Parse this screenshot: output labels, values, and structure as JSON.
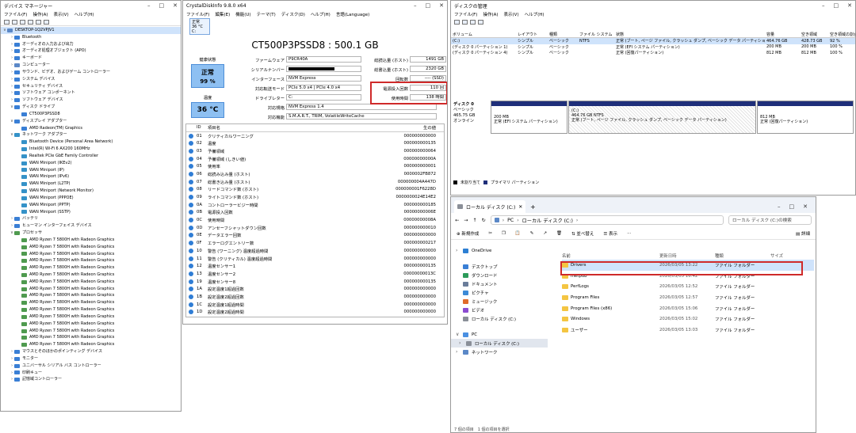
{
  "device_manager": {
    "title": "デバイス マネージャー",
    "menu": [
      "ファイル(F)",
      "操作(A)",
      "表示(V)",
      "ヘルプ(H)"
    ],
    "tree": [
      {
        "label": "DESKTOP-1Q2VPJV1",
        "exp": "∨",
        "indent": 0,
        "icon": "pc",
        "selected": true
      },
      {
        "label": "Bluetooth",
        "exp": "›",
        "indent": 1,
        "icon": "dev"
      },
      {
        "label": "オーディオの入力および出力",
        "exp": "›",
        "indent": 1,
        "icon": "dev"
      },
      {
        "label": "オーディオ処理オブジェクト (APO)",
        "exp": "›",
        "indent": 1,
        "icon": "dev"
      },
      {
        "label": "キーボード",
        "exp": "›",
        "indent": 1,
        "icon": "dev"
      },
      {
        "label": "コンピューター",
        "exp": "›",
        "indent": 1,
        "icon": "pc"
      },
      {
        "label": "サウンド、ビデオ、およびゲーム コントローラー",
        "exp": "›",
        "indent": 1,
        "icon": "dev"
      },
      {
        "label": "システム デバイス",
        "exp": "›",
        "indent": 1,
        "icon": "dev"
      },
      {
        "label": "セキュリティ デバイス",
        "exp": "›",
        "indent": 1,
        "icon": "dev"
      },
      {
        "label": "ソフトウェア コンポーネント",
        "exp": "›",
        "indent": 1,
        "icon": "dev"
      },
      {
        "label": "ソフトウェア デバイス",
        "exp": "›",
        "indent": 1,
        "icon": "dev"
      },
      {
        "label": "ディスク ドライブ",
        "exp": "∨",
        "indent": 1,
        "icon": "dev"
      },
      {
        "label": "CT500P3PSSD8",
        "exp": "",
        "indent": 2,
        "icon": "dev"
      },
      {
        "label": "ディスプレイ アダプター",
        "exp": "∨",
        "indent": 1,
        "icon": "dev"
      },
      {
        "label": "AMD Radeon(TM) Graphics",
        "exp": "",
        "indent": 2,
        "icon": "dev"
      },
      {
        "label": "ネットワーク アダプター",
        "exp": "∨",
        "indent": 1,
        "icon": "net"
      },
      {
        "label": "Bluetooth Device (Personal Area Network)",
        "exp": "",
        "indent": 2,
        "icon": "net"
      },
      {
        "label": "Intel(R) Wi-Fi 6 AX200 160MHz",
        "exp": "",
        "indent": 2,
        "icon": "net"
      },
      {
        "label": "Realtek PCIe GbE Family Controller",
        "exp": "",
        "indent": 2,
        "icon": "net"
      },
      {
        "label": "WAN Miniport (IKEv2)",
        "exp": "",
        "indent": 2,
        "icon": "net"
      },
      {
        "label": "WAN Miniport (IP)",
        "exp": "",
        "indent": 2,
        "icon": "net"
      },
      {
        "label": "WAN Miniport (IPv6)",
        "exp": "",
        "indent": 2,
        "icon": "net"
      },
      {
        "label": "WAN Miniport (L2TP)",
        "exp": "",
        "indent": 2,
        "icon": "net"
      },
      {
        "label": "WAN Miniport (Network Monitor)",
        "exp": "",
        "indent": 2,
        "icon": "net"
      },
      {
        "label": "WAN Miniport (PPPOE)",
        "exp": "",
        "indent": 2,
        "icon": "net"
      },
      {
        "label": "WAN Miniport (PPTP)",
        "exp": "",
        "indent": 2,
        "icon": "net"
      },
      {
        "label": "WAN Miniport (SSTP)",
        "exp": "",
        "indent": 2,
        "icon": "net"
      },
      {
        "label": "バッテリ",
        "exp": "›",
        "indent": 1,
        "icon": "dev"
      },
      {
        "label": "ヒューマン インターフェイス デバイス",
        "exp": "›",
        "indent": 1,
        "icon": "dev"
      },
      {
        "label": "プロセッサ",
        "exp": "∨",
        "indent": 1,
        "icon": "cpu"
      },
      {
        "label": "AMD Ryzen 7 5800H with Radeon Graphics",
        "exp": "",
        "indent": 2,
        "icon": "cpu"
      },
      {
        "label": "AMD Ryzen 7 5800H with Radeon Graphics",
        "exp": "",
        "indent": 2,
        "icon": "cpu"
      },
      {
        "label": "AMD Ryzen 7 5800H with Radeon Graphics",
        "exp": "",
        "indent": 2,
        "icon": "cpu"
      },
      {
        "label": "AMD Ryzen 7 5800H with Radeon Graphics",
        "exp": "",
        "indent": 2,
        "icon": "cpu"
      },
      {
        "label": "AMD Ryzen 7 5800H with Radeon Graphics",
        "exp": "",
        "indent": 2,
        "icon": "cpu"
      },
      {
        "label": "AMD Ryzen 7 5800H with Radeon Graphics",
        "exp": "",
        "indent": 2,
        "icon": "cpu"
      },
      {
        "label": "AMD Ryzen 7 5800H with Radeon Graphics",
        "exp": "",
        "indent": 2,
        "icon": "cpu"
      },
      {
        "label": "AMD Ryzen 7 5800H with Radeon Graphics",
        "exp": "",
        "indent": 2,
        "icon": "cpu"
      },
      {
        "label": "AMD Ryzen 7 5800H with Radeon Graphics",
        "exp": "",
        "indent": 2,
        "icon": "cpu"
      },
      {
        "label": "AMD Ryzen 7 5800H with Radeon Graphics",
        "exp": "",
        "indent": 2,
        "icon": "cpu"
      },
      {
        "label": "AMD Ryzen 7 5800H with Radeon Graphics",
        "exp": "",
        "indent": 2,
        "icon": "cpu"
      },
      {
        "label": "AMD Ryzen 7 5800H with Radeon Graphics",
        "exp": "",
        "indent": 2,
        "icon": "cpu"
      },
      {
        "label": "AMD Ryzen 7 5800H with Radeon Graphics",
        "exp": "",
        "indent": 2,
        "icon": "cpu"
      },
      {
        "label": "AMD Ryzen 7 5800H with Radeon Graphics",
        "exp": "",
        "indent": 2,
        "icon": "cpu"
      },
      {
        "label": "AMD Ryzen 7 5800H with Radeon Graphics",
        "exp": "",
        "indent": 2,
        "icon": "cpu"
      },
      {
        "label": "AMD Ryzen 7 5800H with Radeon Graphics",
        "exp": "",
        "indent": 2,
        "icon": "cpu"
      },
      {
        "label": "マウスとそのほかのポインティング デバイス",
        "exp": "›",
        "indent": 1,
        "icon": "dev"
      },
      {
        "label": "モニター",
        "exp": "›",
        "indent": 1,
        "icon": "dev"
      },
      {
        "label": "ユニバーサル シリアル バス コントローラー",
        "exp": "›",
        "indent": 1,
        "icon": "dev"
      },
      {
        "label": "印刷キュー",
        "exp": "›",
        "indent": 1,
        "icon": "dev"
      },
      {
        "label": "記憶域コントローラー",
        "exp": "›",
        "indent": 1,
        "icon": "dev"
      }
    ]
  },
  "cdi": {
    "title": "CrystalDiskInfo 9.8.0 x64",
    "menu": [
      "ファイル(F)",
      "編集(E)",
      "機能(U)",
      "テーマ(T)",
      "ディスク(D)",
      "ヘルプ(H)",
      "言語(Language)"
    ],
    "mini_status": "正常",
    "mini_temp": "36 °C",
    "mini_drive": "C:",
    "model": "CT500P3PSSD8 : 500.1 GB",
    "health_label": "健康状態",
    "health_status": "正常",
    "health_percent": "99 %",
    "temp_label": "温度",
    "temp_value": "36 °C",
    "firmware_label": "ファームウェア",
    "firmware": "P9CR40A",
    "serial_label": "シリアルナンバー",
    "interface_label": "インターフェース",
    "interface": "NVM Express",
    "transfer_label": "対応転送モード",
    "transfer": "PCIe 5.0 x4 | PCIe 4.0 x4",
    "drive_letter_label": "ドライブレター",
    "drive_letter": "C:",
    "standard_label": "対応規格",
    "standard": "NVM Express 1.4",
    "features_label": "対応機能",
    "features": "S.M.A.R.T., TRIM, VolatileWriteCache",
    "host_reads_label": "総読込量 (ホスト)",
    "host_reads": "1491 GB",
    "host_writes_label": "総書込量 (ホスト)",
    "host_writes": "2320 GB",
    "rotation_label": "回転数",
    "rotation": "---- (SSD)",
    "power_on_count_label": "電源投入回数",
    "power_on_count": "110 回",
    "power_on_hours_label": "使用時間",
    "power_on_hours": "138 時間",
    "smart_headers": {
      "id": "ID",
      "name": "項目名",
      "raw": "生の値"
    },
    "smart": [
      {
        "id": "01",
        "name": "クリティカルワーニング",
        "raw": "000000000000"
      },
      {
        "id": "02",
        "name": "温度",
        "raw": "000000000135"
      },
      {
        "id": "03",
        "name": "予備領域",
        "raw": "000000000064"
      },
      {
        "id": "04",
        "name": "予備領域 (しきい値)",
        "raw": "00000000000A"
      },
      {
        "id": "05",
        "name": "使用率",
        "raw": "000000000001"
      },
      {
        "id": "06",
        "name": "総読み込み量 (ホスト)",
        "raw": "0000002FB872"
      },
      {
        "id": "07",
        "name": "総書き込み量 (ホスト)",
        "raw": "000000004A447D"
      },
      {
        "id": "08",
        "name": "リードコマンド数 (ホスト)",
        "raw": "000000001F6228D"
      },
      {
        "id": "09",
        "name": "ライトコマンド数 (ホスト)",
        "raw": "0000000024E14E2"
      },
      {
        "id": "0A",
        "name": "コントローラービジー時間",
        "raw": "000000000185"
      },
      {
        "id": "0B",
        "name": "電源投入回数",
        "raw": "00000000006E"
      },
      {
        "id": "0C",
        "name": "使用時間",
        "raw": "00000000008A"
      },
      {
        "id": "0D",
        "name": "アンセーフシャットダウン回数",
        "raw": "000000000010"
      },
      {
        "id": "0E",
        "name": "データエラー回数",
        "raw": "000000000000"
      },
      {
        "id": "0F",
        "name": "エラーログエントリー数",
        "raw": "000000000217"
      },
      {
        "id": "10",
        "name": "警告 (ワーニング) 温度超過時間",
        "raw": "000000000000"
      },
      {
        "id": "11",
        "name": "警告 (クリティカル) 温度超過時間",
        "raw": "000000000000"
      },
      {
        "id": "12",
        "name": "温度センサー1",
        "raw": "000000000135"
      },
      {
        "id": "13",
        "name": "温度センサー2",
        "raw": "00000000013C"
      },
      {
        "id": "19",
        "name": "温度センサー8",
        "raw": "000000000135"
      },
      {
        "id": "1A",
        "name": "設定温度1超過回数",
        "raw": "000000000000"
      },
      {
        "id": "1B",
        "name": "設定温度2超過回数",
        "raw": "000000000000"
      },
      {
        "id": "1C",
        "name": "設定温度1超過時間",
        "raw": "000000000000"
      },
      {
        "id": "1D",
        "name": "設定温度2超過時間",
        "raw": "000000000000"
      }
    ]
  },
  "disk_mgmt": {
    "title": "ディスクの管理",
    "menu": [
      "ファイル(F)",
      "操作(A)",
      "表示(V)",
      "ヘルプ(H)"
    ],
    "headers": [
      "ボリューム",
      "レイアウト",
      "種類",
      "ファイル システム",
      "状態",
      "容量",
      "空き領域",
      "空き領域の割合"
    ],
    "volumes": [
      {
        "name": "(C:)",
        "layout": "シンプル",
        "type": "ベーシック",
        "fs": "NTFS",
        "status": "正常 (ブート, ページ ファイル, クラッシュ ダンプ, ベーシック データ パーティション)",
        "size": "464.76 GB",
        "free": "428.73 GB",
        "pct": "92 %"
      },
      {
        "name": "(ディスク 0 パーティション 1)",
        "layout": "シンプル",
        "type": "ベーシック",
        "fs": "",
        "status": "正常 (EFI システム パーティション)",
        "size": "200 MB",
        "free": "200 MB",
        "pct": "100 %"
      },
      {
        "name": "(ディスク 0 パーティション 4)",
        "layout": "シンプル",
        "type": "ベーシック",
        "fs": "",
        "status": "正常 (回復パーティション)",
        "size": "812 MB",
        "free": "812 MB",
        "pct": "100 %"
      }
    ],
    "disk0": {
      "name": "ディスク 0",
      "type": "ベーシック",
      "size": "465.75 GB",
      "state": "オンライン"
    },
    "partitions": [
      {
        "line1": "200 MB",
        "line2": "正常 (EFI システム パーティション)",
        "line0": ""
      },
      {
        "line0": "(C:)",
        "line1": "464.76 GB NTFS",
        "line2": "正常 (ブート, ページ ファイル, クラッシュ ダンプ, ベーシック データ パーティション)"
      },
      {
        "line1": "812 MB",
        "line2": "正常 (回復パーティション)",
        "line0": ""
      }
    ],
    "legend_unallocated": "未割り当て",
    "legend_primary": "プライマリ パーティション"
  },
  "explorer": {
    "tab_title": "ローカル ディスク (C:)",
    "path_pc": "PC",
    "path_disk": "ローカル ディスク (C:)",
    "search_placeholder": "ローカル ディスク (C:)の検索",
    "new_label": "新規作成",
    "sort_label": "並べ替え",
    "view_label": "表示",
    "details_label": "詳細",
    "nav": [
      {
        "label": "OneDrive",
        "exp": "›",
        "icon": "cloud"
      },
      {
        "label": "デスクトップ",
        "exp": "",
        "icon": "desk"
      },
      {
        "label": "ダウンロード",
        "exp": "",
        "icon": "down"
      },
      {
        "label": "ドキュメント",
        "exp": "",
        "icon": "doc"
      },
      {
        "label": "ピクチャ",
        "exp": "",
        "icon": "pic"
      },
      {
        "label": "ミュージック",
        "exp": "",
        "icon": "music"
      },
      {
        "label": "ビデオ",
        "exp": "",
        "icon": "video"
      },
      {
        "label": "ローカル ディスク (C:)",
        "exp": "",
        "icon": "drive"
      },
      {
        "label": "PC",
        "exp": "∨",
        "icon": "pc"
      },
      {
        "label": "ローカル ディスク (C:)",
        "exp": "›",
        "icon": "drive",
        "selected": true
      },
      {
        "label": "ネットワーク",
        "exp": "›",
        "icon": "net"
      }
    ],
    "headers": {
      "name": "名前",
      "date": "更新日時",
      "type": "種類",
      "size": "サイズ"
    },
    "files": [
      {
        "name": "Drivers",
        "date": "2026/03/05 13:22",
        "type": "ファイル フォルダー",
        "selected": true
      },
      {
        "name": "inetpub",
        "date": "2026/03/05 16:42",
        "type": "ファイル フォルダー"
      },
      {
        "name": "PerfLogs",
        "date": "2026/03/05 12:52",
        "type": "ファイル フォルダー"
      },
      {
        "name": "Program Files",
        "date": "2026/03/05 12:57",
        "type": "ファイル フォルダー"
      },
      {
        "name": "Program Files (x86)",
        "date": "2026/03/05 15:06",
        "type": "ファイル フォルダー"
      },
      {
        "name": "Windows",
        "date": "2026/03/05 15:02",
        "type": "ファイル フォルダー"
      },
      {
        "name": "ユーザー",
        "date": "2026/03/05 13:03",
        "type": "ファイル フォルダー"
      }
    ],
    "status": "7 個の項目　1 個の項目を選択"
  },
  "colors": {
    "highlight_red": "#cf2a2a",
    "health_blue": "#4d8ed8",
    "partition_bar": "#1f2f7a",
    "folder": "#f4c542"
  }
}
